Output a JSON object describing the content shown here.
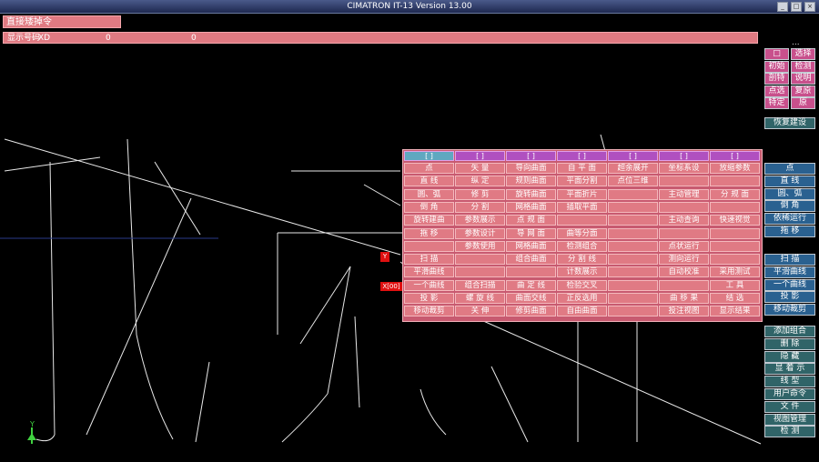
{
  "window": {
    "title": "CIMATRON IT-13 Version 13.00",
    "buttons": [
      "_",
      "□",
      "×"
    ]
  },
  "prompts": {
    "line1": "直接矮掉令",
    "line2_label": "显示号码",
    "line2_val1": "XD",
    "line2_val2": "0",
    "line2_val3": "0",
    "dots": "..."
  },
  "right_top": [
    [
      "□",
      "选择"
    ],
    [
      "初始",
      "检测"
    ],
    [
      "剖特",
      "说明"
    ],
    [
      "点选",
      "复原"
    ],
    [
      "特定",
      "原"
    ]
  ],
  "right_single1": "恢复建设",
  "right_group1": [
    "点",
    "直 线",
    "圆、弧",
    "倒 角",
    "依稀运行",
    "拖 移"
  ],
  "right_group2": [
    "扫 描",
    "平滑曲线",
    "一个曲线",
    "投 影",
    "移动裁剪"
  ],
  "right_group3": [
    "添加组合",
    "删 除",
    "隐 藏",
    "显 着 示",
    "线 型",
    "用户命令",
    "文 件",
    "视图管理",
    "检 测"
  ],
  "menu": {
    "headers": [
      "[ ]",
      "[ ]",
      "[ ]",
      "[ ]",
      "[ ]",
      "[ ]",
      "[ ]"
    ],
    "rows": [
      [
        "点",
        "矢 量",
        "导向曲面",
        "自 平 面",
        "超余展开",
        "坐标系设",
        "放缩参数"
      ],
      [
        "直 线",
        "纵 定",
        "规则曲面",
        "平面分割",
        "点位三维",
        "",
        ""
      ],
      [
        "圆、弧",
        "修 剪",
        "旋转曲面",
        "平面折片",
        "",
        "主动管理",
        "分 规 面"
      ],
      [
        "倒 角",
        "分 割",
        "网格曲面",
        "插取平面",
        "",
        "",
        ""
      ],
      [
        "旋转建曲",
        "参数展示",
        "点 规 面",
        "",
        "",
        "主动查询",
        "快速视觉"
      ],
      [
        "拖 移",
        "参数设计",
        "导 网 面",
        "曲等分面",
        "",
        "",
        ""
      ],
      [
        "",
        "参数使用",
        "网格曲面",
        "检测组合",
        "",
        "点状运行",
        ""
      ],
      [
        "扫 描",
        "",
        "组合曲面",
        "分 割 线",
        "",
        "测向运行",
        ""
      ],
      [
        "平滑曲线",
        "",
        "",
        "计数展示",
        "",
        "自动校准",
        "采用测试"
      ],
      [
        "一个曲线",
        "组合扫描",
        "曲 定 线",
        "检验交叉",
        "",
        "",
        "工 具"
      ],
      [
        "投 影",
        "螺 旋 线",
        "曲面交线",
        "正反选用",
        "",
        "曲 移 果",
        "结 选"
      ],
      [
        "移动裁剪",
        "关 伸",
        "修剪曲面",
        "自由曲面",
        "",
        "投注视图",
        "显示结果"
      ]
    ]
  },
  "markers": {
    "y_box": "Y",
    "coord_label": "X[00]",
    "axis_y": "Y"
  }
}
